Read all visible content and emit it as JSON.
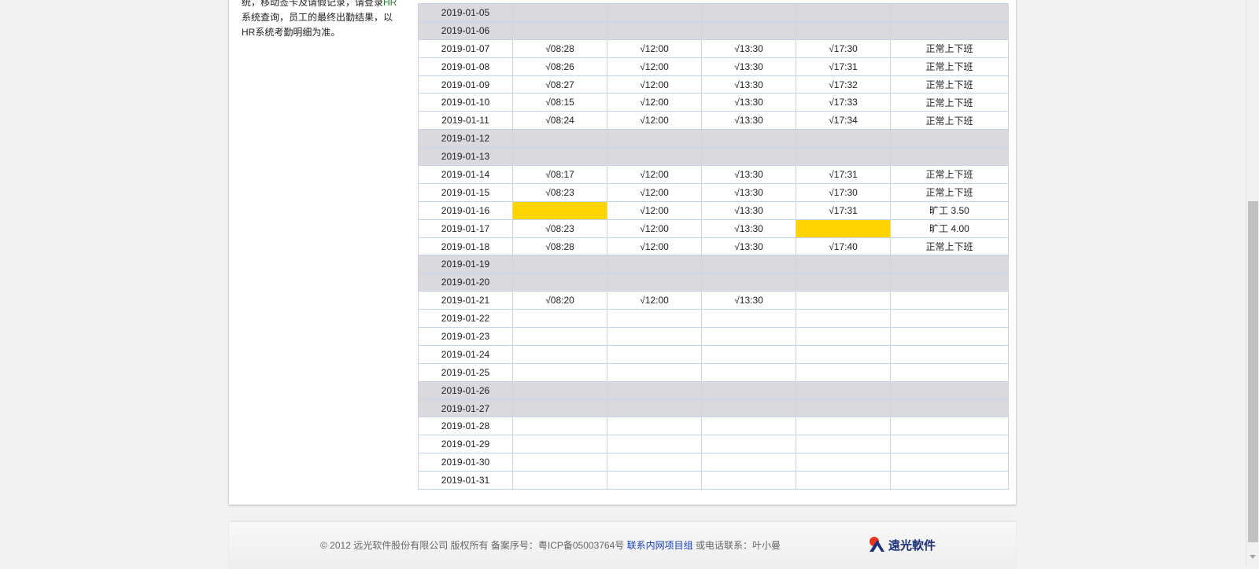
{
  "notice": {
    "line1_prefix": "统，移动签卡及请假记录，请登录",
    "line1_hr": "HR",
    "line2": "系统查询，员工的最终出勤结果，以",
    "line3": "HR系统考勤明细为准。"
  },
  "rows": [
    {
      "date": "2019-01-05",
      "t1": "",
      "t2": "",
      "t3": "",
      "t4": "",
      "status": "",
      "weekend": true
    },
    {
      "date": "2019-01-06",
      "t1": "",
      "t2": "",
      "t3": "",
      "t4": "",
      "status": "",
      "weekend": true
    },
    {
      "date": "2019-01-07",
      "t1": "√08:28",
      "t2": "√12:00",
      "t3": "√13:30",
      "t4": "√17:30",
      "status": "正常上下班",
      "weekend": false
    },
    {
      "date": "2019-01-08",
      "t1": "√08:26",
      "t2": "√12:00",
      "t3": "√13:30",
      "t4": "√17:31",
      "status": "正常上下班",
      "weekend": false
    },
    {
      "date": "2019-01-09",
      "t1": "√08:27",
      "t2": "√12:00",
      "t3": "√13:30",
      "t4": "√17:32",
      "status": "正常上下班",
      "weekend": false
    },
    {
      "date": "2019-01-10",
      "t1": "√08:15",
      "t2": "√12:00",
      "t3": "√13:30",
      "t4": "√17:33",
      "status": "正常上下班",
      "weekend": false
    },
    {
      "date": "2019-01-11",
      "t1": "√08:24",
      "t2": "√12:00",
      "t3": "√13:30",
      "t4": "√17:34",
      "status": "正常上下班",
      "weekend": false
    },
    {
      "date": "2019-01-12",
      "t1": "",
      "t2": "",
      "t3": "",
      "t4": "",
      "status": "",
      "weekend": true
    },
    {
      "date": "2019-01-13",
      "t1": "",
      "t2": "",
      "t3": "",
      "t4": "",
      "status": "",
      "weekend": true
    },
    {
      "date": "2019-01-14",
      "t1": "√08:17",
      "t2": "√12:00",
      "t3": "√13:30",
      "t4": "√17:31",
      "status": "正常上下班",
      "weekend": false
    },
    {
      "date": "2019-01-15",
      "t1": "√08:23",
      "t2": "√12:00",
      "t3": "√13:30",
      "t4": "√17:30",
      "status": "正常上下班",
      "weekend": false
    },
    {
      "date": "2019-01-16",
      "t1": "",
      "t2": "√12:00",
      "t3": "√13:30",
      "t4": "√17:31",
      "status": "旷工 3.50",
      "weekend": false,
      "missing": [
        "t1"
      ]
    },
    {
      "date": "2019-01-17",
      "t1": "√08:23",
      "t2": "√12:00",
      "t3": "√13:30",
      "t4": "",
      "status": "旷工 4.00",
      "weekend": false,
      "missing": [
        "t4"
      ]
    },
    {
      "date": "2019-01-18",
      "t1": "√08:28",
      "t2": "√12:00",
      "t3": "√13:30",
      "t4": "√17:40",
      "status": "正常上下班",
      "weekend": false
    },
    {
      "date": "2019-01-19",
      "t1": "",
      "t2": "",
      "t3": "",
      "t4": "",
      "status": "",
      "weekend": true
    },
    {
      "date": "2019-01-20",
      "t1": "",
      "t2": "",
      "t3": "",
      "t4": "",
      "status": "",
      "weekend": true
    },
    {
      "date": "2019-01-21",
      "t1": "√08:20",
      "t2": "√12:00",
      "t3": "√13:30",
      "t4": "",
      "status": "",
      "weekend": false
    },
    {
      "date": "2019-01-22",
      "t1": "",
      "t2": "",
      "t3": "",
      "t4": "",
      "status": "",
      "weekend": false
    },
    {
      "date": "2019-01-23",
      "t1": "",
      "t2": "",
      "t3": "",
      "t4": "",
      "status": "",
      "weekend": false
    },
    {
      "date": "2019-01-24",
      "t1": "",
      "t2": "",
      "t3": "",
      "t4": "",
      "status": "",
      "weekend": false
    },
    {
      "date": "2019-01-25",
      "t1": "",
      "t2": "",
      "t3": "",
      "t4": "",
      "status": "",
      "weekend": false
    },
    {
      "date": "2019-01-26",
      "t1": "",
      "t2": "",
      "t3": "",
      "t4": "",
      "status": "",
      "weekend": true
    },
    {
      "date": "2019-01-27",
      "t1": "",
      "t2": "",
      "t3": "",
      "t4": "",
      "status": "",
      "weekend": true
    },
    {
      "date": "2019-01-28",
      "t1": "",
      "t2": "",
      "t3": "",
      "t4": "",
      "status": "",
      "weekend": false
    },
    {
      "date": "2019-01-29",
      "t1": "",
      "t2": "",
      "t3": "",
      "t4": "",
      "status": "",
      "weekend": false
    },
    {
      "date": "2019-01-30",
      "t1": "",
      "t2": "",
      "t3": "",
      "t4": "",
      "status": "",
      "weekend": false
    },
    {
      "date": "2019-01-31",
      "t1": "",
      "t2": "",
      "t3": "",
      "t4": "",
      "status": "",
      "weekend": false
    }
  ],
  "colors": {
    "weekend_bg": "#d9d9de",
    "missing_punch": "#ffd400",
    "grid_border": "#c4d3f0",
    "link": "#1a3fb7",
    "logo_red": "#e8341c",
    "logo_blue": "#1b2f7a"
  },
  "footer": {
    "copyright": "© 2012 远光软件股份有限公司  版权所有  备案序号：粤ICP备05003764号",
    "link_label": "联系内网项目组",
    "contact": "或电话联系：叶小曼",
    "logo_text": "遠光軟件",
    "logo_icon": "ygsoft-logo-icon"
  }
}
